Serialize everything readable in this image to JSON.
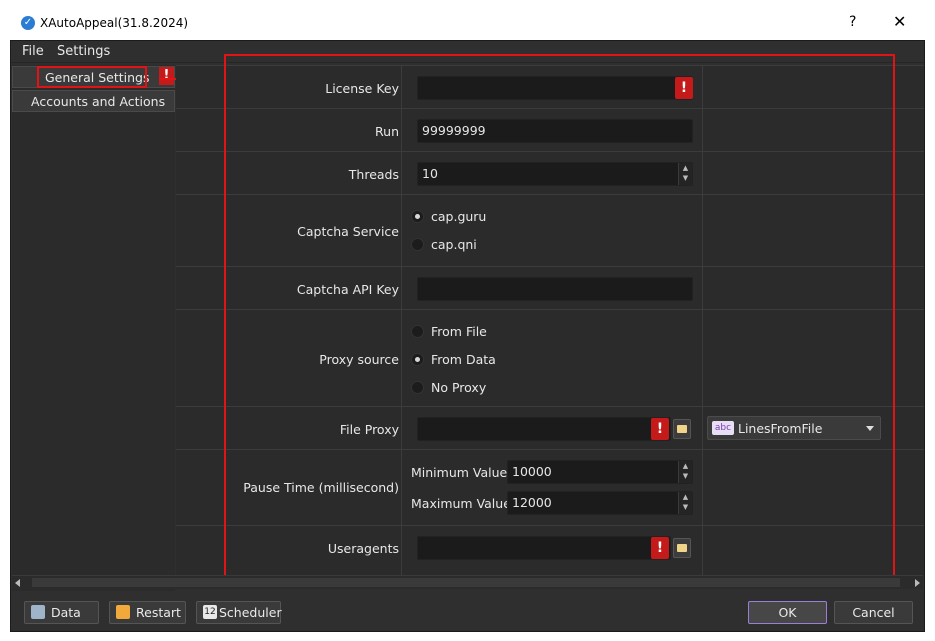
{
  "window": {
    "title": "XAutoAppeal(31.8.2024)",
    "help": "?",
    "close": "✕"
  },
  "menu": {
    "items": [
      "File",
      "Settings"
    ]
  },
  "sidebar": {
    "items": [
      {
        "label": "General Settings"
      },
      {
        "label": "Accounts and Actions"
      }
    ],
    "warn": "!"
  },
  "form": {
    "license_key": {
      "label": "License Key",
      "value": "",
      "warn": "!"
    },
    "run": {
      "label": "Run",
      "value": "99999999"
    },
    "threads": {
      "label": "Threads",
      "value": "10"
    },
    "captcha_service": {
      "label": "Captcha Service",
      "options": [
        "cap.guru",
        "cap.qni"
      ],
      "selected": "cap.guru"
    },
    "captcha_api_key": {
      "label": "Captcha API Key",
      "value": ""
    },
    "proxy_source": {
      "label": "Proxy source",
      "options": [
        "From File",
        "From Data",
        "No Proxy"
      ],
      "selected": "From Data"
    },
    "file_proxy": {
      "label": "File Proxy",
      "value": "",
      "warn": "!",
      "combo_icon": "abc",
      "combo_value": "LinesFromFile"
    },
    "pause_time": {
      "label": "Pause Time (millisecond)",
      "min_label": "Minimum Value",
      "min_value": "10000",
      "max_label": "Maximum Value",
      "max_value": "12000"
    },
    "useragents": {
      "label": "Useragents",
      "value": "",
      "warn": "!"
    }
  },
  "footer": {
    "data": "Data",
    "restart": "Restart",
    "scheduler": "Scheduler",
    "scheduler_icon": "12",
    "ok": "OK",
    "cancel": "Cancel"
  },
  "colors": {
    "accent_red": "#e01414",
    "warn_red": "#c41a1a",
    "bg_dark": "#2b2b2b",
    "field_bg": "#1b1b1b"
  }
}
